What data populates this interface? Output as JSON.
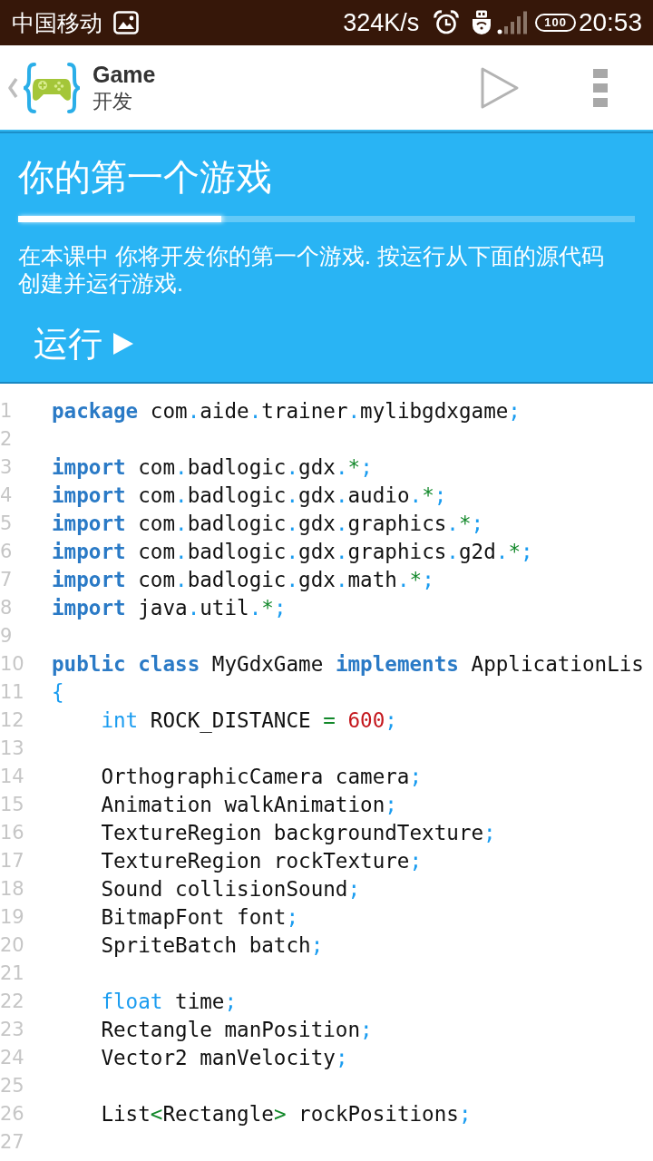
{
  "status_bar": {
    "carrier": "中国移动",
    "speed": "324K/s",
    "battery": "100",
    "time": "20:53"
  },
  "app_bar": {
    "title": "Game",
    "subtitle": "开发"
  },
  "lesson": {
    "title": "你的第一个游戏",
    "progress": {
      "level": 0.33
    },
    "description": "在本课中 你将开发你的第一个游戏. 按运行从下面的源代码创建并运行游戏.",
    "run_button": "运行"
  },
  "code": {
    "lines": [
      {
        "number": "1",
        "tokens": [
          {
            "kind": "keyword",
            "text": "package"
          },
          {
            "kind": "plain",
            "text": " com"
          },
          {
            "kind": "punct",
            "text": "."
          },
          {
            "kind": "plain",
            "text": "aide"
          },
          {
            "kind": "punct",
            "text": "."
          },
          {
            "kind": "plain",
            "text": "trainer"
          },
          {
            "kind": "punct",
            "text": "."
          },
          {
            "kind": "plain",
            "text": "mylibgdxgame"
          },
          {
            "kind": "punct",
            "text": ";"
          }
        ]
      },
      {
        "number": "2"
      },
      {
        "number": "3",
        "tokens": [
          {
            "kind": "keyword",
            "text": "import"
          },
          {
            "kind": "plain",
            "text": " com"
          },
          {
            "kind": "punct",
            "text": "."
          },
          {
            "kind": "plain",
            "text": "badlogic"
          },
          {
            "kind": "punct",
            "text": "."
          },
          {
            "kind": "plain",
            "text": "gdx"
          },
          {
            "kind": "punct",
            "text": "."
          },
          {
            "kind": "operator",
            "text": "*"
          },
          {
            "kind": "punct",
            "text": ";"
          }
        ]
      },
      {
        "number": "4",
        "tokens": [
          {
            "kind": "keyword",
            "text": "import"
          },
          {
            "kind": "plain",
            "text": " com"
          },
          {
            "kind": "punct",
            "text": "."
          },
          {
            "kind": "plain",
            "text": "badlogic"
          },
          {
            "kind": "punct",
            "text": "."
          },
          {
            "kind": "plain",
            "text": "gdx"
          },
          {
            "kind": "punct",
            "text": "."
          },
          {
            "kind": "plain",
            "text": "audio"
          },
          {
            "kind": "punct",
            "text": "."
          },
          {
            "kind": "operator",
            "text": "*"
          },
          {
            "kind": "punct",
            "text": ";"
          }
        ]
      },
      {
        "number": "5",
        "tokens": [
          {
            "kind": "keyword",
            "text": "import"
          },
          {
            "kind": "plain",
            "text": " com"
          },
          {
            "kind": "punct",
            "text": "."
          },
          {
            "kind": "plain",
            "text": "badlogic"
          },
          {
            "kind": "punct",
            "text": "."
          },
          {
            "kind": "plain",
            "text": "gdx"
          },
          {
            "kind": "punct",
            "text": "."
          },
          {
            "kind": "plain",
            "text": "graphics"
          },
          {
            "kind": "punct",
            "text": "."
          },
          {
            "kind": "operator",
            "text": "*"
          },
          {
            "kind": "punct",
            "text": ";"
          }
        ]
      },
      {
        "number": "6",
        "tokens": [
          {
            "kind": "keyword",
            "text": "import"
          },
          {
            "kind": "plain",
            "text": " com"
          },
          {
            "kind": "punct",
            "text": "."
          },
          {
            "kind": "plain",
            "text": "badlogic"
          },
          {
            "kind": "punct",
            "text": "."
          },
          {
            "kind": "plain",
            "text": "gdx"
          },
          {
            "kind": "punct",
            "text": "."
          },
          {
            "kind": "plain",
            "text": "graphics"
          },
          {
            "kind": "punct",
            "text": "."
          },
          {
            "kind": "plain",
            "text": "g2d"
          },
          {
            "kind": "punct",
            "text": "."
          },
          {
            "kind": "operator",
            "text": "*"
          },
          {
            "kind": "punct",
            "text": ";"
          }
        ]
      },
      {
        "number": "7",
        "tokens": [
          {
            "kind": "keyword",
            "text": "import"
          },
          {
            "kind": "plain",
            "text": " com"
          },
          {
            "kind": "punct",
            "text": "."
          },
          {
            "kind": "plain",
            "text": "badlogic"
          },
          {
            "kind": "punct",
            "text": "."
          },
          {
            "kind": "plain",
            "text": "gdx"
          },
          {
            "kind": "punct",
            "text": "."
          },
          {
            "kind": "plain",
            "text": "math"
          },
          {
            "kind": "punct",
            "text": "."
          },
          {
            "kind": "operator",
            "text": "*"
          },
          {
            "kind": "punct",
            "text": ";"
          }
        ]
      },
      {
        "number": "8",
        "tokens": [
          {
            "kind": "keyword",
            "text": "import"
          },
          {
            "kind": "plain",
            "text": " java"
          },
          {
            "kind": "punct",
            "text": "."
          },
          {
            "kind": "plain",
            "text": "util"
          },
          {
            "kind": "punct",
            "text": "."
          },
          {
            "kind": "operator",
            "text": "*"
          },
          {
            "kind": "punct",
            "text": ";"
          }
        ]
      },
      {
        "number": "9"
      },
      {
        "number": "10",
        "tokens": [
          {
            "kind": "keyword",
            "text": "public"
          },
          {
            "kind": "keyword",
            "text": " class"
          },
          {
            "kind": "plain",
            "text": " MyGdxGame "
          },
          {
            "kind": "keyword",
            "text": "implements"
          },
          {
            "kind": "plain",
            "text": " ApplicationLis"
          }
        ]
      },
      {
        "number": "11",
        "tokens": [
          {
            "kind": "punct",
            "text": "{"
          }
        ]
      },
      {
        "number": "12",
        "tokens": [
          {
            "kind": "primitive",
            "text": "    int"
          },
          {
            "kind": "plain",
            "text": " ROCK_DISTANCE "
          },
          {
            "kind": "operator",
            "text": "="
          },
          {
            "kind": "number",
            "text": " 600"
          },
          {
            "kind": "punct",
            "text": ";"
          }
        ]
      },
      {
        "number": "13"
      },
      {
        "number": "14",
        "tokens": [
          {
            "kind": "plain",
            "text": "    OrthographicCamera camera"
          },
          {
            "kind": "punct",
            "text": ";"
          }
        ]
      },
      {
        "number": "15",
        "tokens": [
          {
            "kind": "plain",
            "text": "    Animation walkAnimation"
          },
          {
            "kind": "punct",
            "text": ";"
          }
        ]
      },
      {
        "number": "16",
        "tokens": [
          {
            "kind": "plain",
            "text": "    TextureRegion backgroundTexture"
          },
          {
            "kind": "punct",
            "text": ";"
          }
        ]
      },
      {
        "number": "17",
        "tokens": [
          {
            "kind": "plain",
            "text": "    TextureRegion rockTexture"
          },
          {
            "kind": "punct",
            "text": ";"
          }
        ]
      },
      {
        "number": "18",
        "tokens": [
          {
            "kind": "plain",
            "text": "    Sound collisionSound"
          },
          {
            "kind": "punct",
            "text": ";"
          }
        ]
      },
      {
        "number": "19",
        "tokens": [
          {
            "kind": "plain",
            "text": "    BitmapFont font"
          },
          {
            "kind": "punct",
            "text": ";"
          }
        ]
      },
      {
        "number": "20",
        "tokens": [
          {
            "kind": "plain",
            "text": "    SpriteBatch batch"
          },
          {
            "kind": "punct",
            "text": ";"
          }
        ]
      },
      {
        "number": "21"
      },
      {
        "number": "22",
        "tokens": [
          {
            "kind": "primitive",
            "text": "    float"
          },
          {
            "kind": "plain",
            "text": " time"
          },
          {
            "kind": "punct",
            "text": ";"
          }
        ]
      },
      {
        "number": "23",
        "tokens": [
          {
            "kind": "plain",
            "text": "    Rectangle manPosition"
          },
          {
            "kind": "punct",
            "text": ";"
          }
        ]
      },
      {
        "number": "24",
        "tokens": [
          {
            "kind": "plain",
            "text": "    Vector2 manVelocity"
          },
          {
            "kind": "punct",
            "text": ";"
          }
        ]
      },
      {
        "number": "25"
      },
      {
        "number": "26",
        "tokens": [
          {
            "kind": "plain",
            "text": "    List"
          },
          {
            "kind": "operator",
            "text": "<"
          },
          {
            "kind": "plain",
            "text": "Rectangle"
          },
          {
            "kind": "operator",
            "text": ">"
          },
          {
            "kind": "plain",
            "text": " rockPositions"
          },
          {
            "kind": "punct",
            "text": ";"
          }
        ]
      },
      {
        "number": "27"
      }
    ]
  }
}
